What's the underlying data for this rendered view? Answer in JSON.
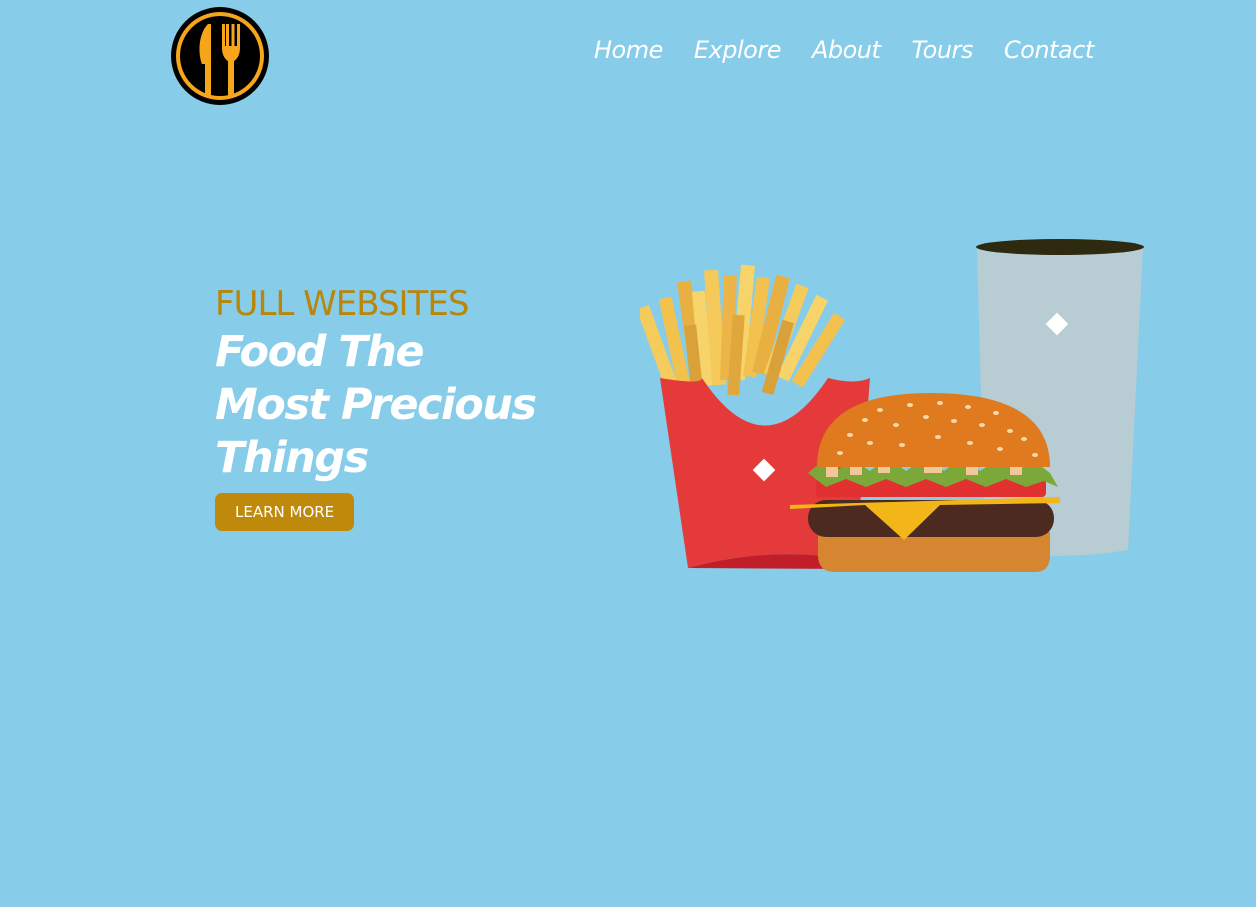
{
  "logo": {
    "icon": "knife-fork-icon",
    "colors": {
      "ring": "#000000",
      "fill": "#f7a61c"
    }
  },
  "nav": {
    "items": [
      "Home",
      "Explore",
      "About",
      "Tours",
      "Contact"
    ]
  },
  "hero": {
    "kicker": "FULL WEBSITES",
    "headline_lines": [
      "Food The",
      "Most Precious",
      "Things"
    ],
    "cta_label": "LEARN MORE"
  },
  "illustration": {
    "items": [
      "fries-icon",
      "burger-icon",
      "drink-cup-icon"
    ]
  },
  "colors": {
    "background": "#87cdea",
    "accent": "#bf8a0c",
    "kicker": "#b8860b",
    "text": "#ffffff"
  }
}
